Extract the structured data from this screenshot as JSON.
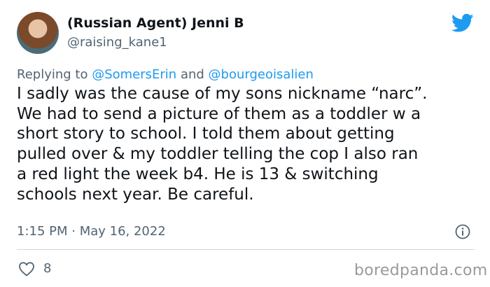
{
  "author": {
    "display_name": "(Russian Agent) Jenni B",
    "handle": "@raising_kane1"
  },
  "reply_context": {
    "prefix": "Replying to ",
    "user1": "@SomersErin",
    "joiner": " and ",
    "user2": "@bourgeoisalien"
  },
  "tweet": {
    "text": "I sadly was the cause of my sons nickname “narc”.\nWe had to send a picture of them as a toddler w a\nshort story to school. I told them about getting\npulled over & my toddler telling the cop I also ran\na red light the week b4. He is 13 & switching\nschools next year. Be careful.",
    "timestamp": "1:15 PM · May 16, 2022",
    "likes": "8"
  },
  "watermark": "boredpanda.com",
  "icons": {
    "brand": "twitter-bird-icon",
    "info": "info-icon",
    "like": "heart-icon"
  },
  "colors": {
    "twitter_blue": "#1d9bf0",
    "secondary_text": "#536471",
    "primary_text": "#0f1419",
    "divider": "#cfd9de"
  }
}
